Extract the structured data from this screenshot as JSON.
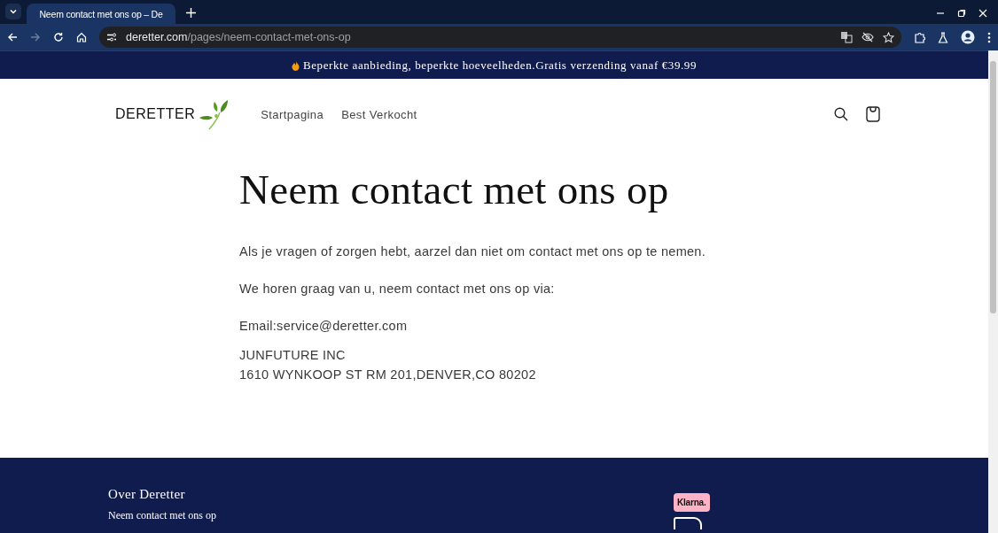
{
  "browser": {
    "tab": {
      "title": "Neem contact met ons op – De"
    },
    "address": {
      "domain": "deretter.com",
      "path": "/pages/neem-contact-met-ons-op"
    }
  },
  "announcement": "Beperkte aanbieding, beperkte hoeveelheden.Gratis verzending vanaf €39.99",
  "header": {
    "logo": "DERETTER",
    "nav": [
      {
        "label": "Startpagina"
      },
      {
        "label": "Best Verkocht"
      }
    ]
  },
  "page": {
    "title": "Neem contact met ons op",
    "paragraphs": [
      "Als je vragen of zorgen hebt, aarzel dan niet om contact met ons op te nemen.",
      "We horen graag van u, neem contact met ons op via:",
      "Email:service@deretter.com"
    ],
    "address_lines": [
      "JUNFUTURE INC",
      "1610 WYNKOOP ST RM 201,DENVER,CO 80202"
    ]
  },
  "footer": {
    "heading": "Over Deretter",
    "links": [
      "Neem contact met ons op"
    ],
    "payment_badge": "Klarna."
  }
}
